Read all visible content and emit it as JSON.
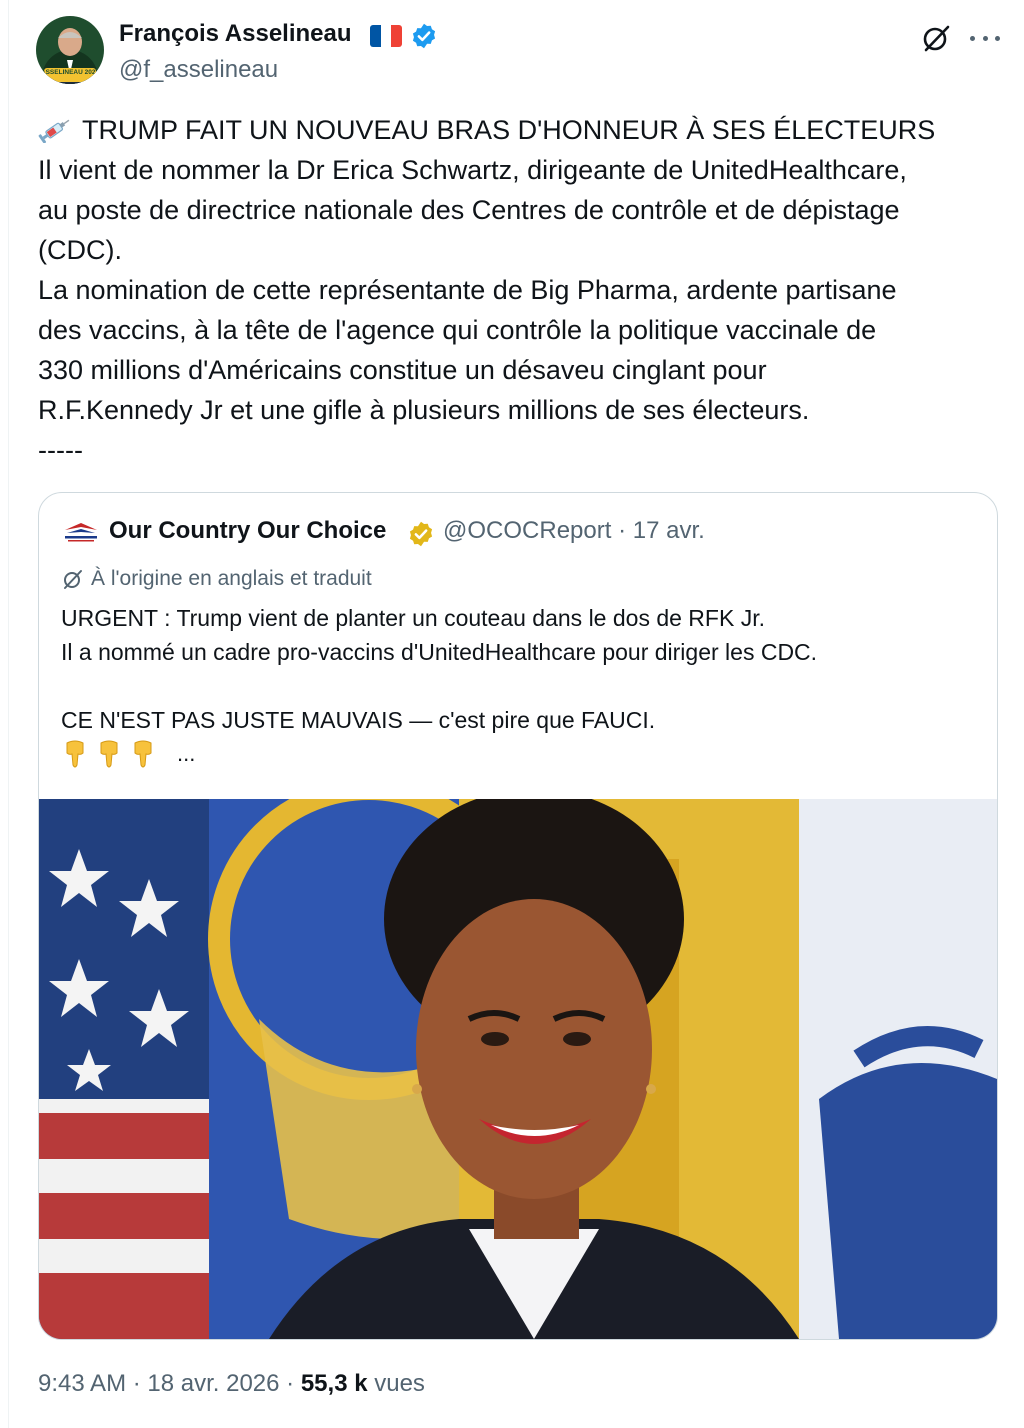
{
  "author": {
    "name": "François Asselineau",
    "handle": "@f_asselineau",
    "avatar_badge": "ASSELINEAU 2027",
    "verified_color": "#1d9bf0",
    "flag": [
      "#0055a4",
      "#ffffff",
      "#ef4135"
    ]
  },
  "icons": {
    "emoji_leading": "syringe-icon",
    "grok": "grok-icon",
    "more": "more-icon",
    "pointing": "backhand-index-pointing-down-icon"
  },
  "tweet": {
    "lines": [
      "TRUMP FAIT UN NOUVEAU BRAS D'HONNEUR À SES ÉLECTEURS",
      "Il vient de nommer la Dr Erica Schwartz, dirigeante de UnitedHealthcare,",
      "au poste de directrice nationale des Centres de contrôle et de dépistage",
      "(CDC).",
      "La nomination de cette représentante de Big Pharma, ardente partisane",
      "des vaccins, à la tête de l'agence qui contrôle la politique vaccinale de",
      "330 millions d'Américains constitue un désaveu cinglant pour",
      "R.F.Kennedy Jr et une gifle à plusieurs millions de ses électeurs.",
      "-----"
    ]
  },
  "quote": {
    "name": "Our Country Our Choice",
    "handle_date": "@OCOCReport · 17 avr.",
    "gold_badge_color": "#e2b719",
    "translated_label": "À l'origine en anglais et traduit",
    "body_lines": [
      "URGENT : Trump vient de planter un couteau dans le dos de RFK Jr.",
      "Il a nommé un cadre pro-vaccins d'UnitedHealthcare pour diriger les CDC.",
      "",
      "CE N'EST PAS JUSTE MAUVAIS — c'est pire que FAUCI."
    ],
    "ellipsis": "...",
    "pointing_count": 3
  },
  "footer": {
    "time_date": "9:43 AM · 18 avr. 2026 · ",
    "views_count": "55,3 k",
    "views_label": " vues"
  }
}
